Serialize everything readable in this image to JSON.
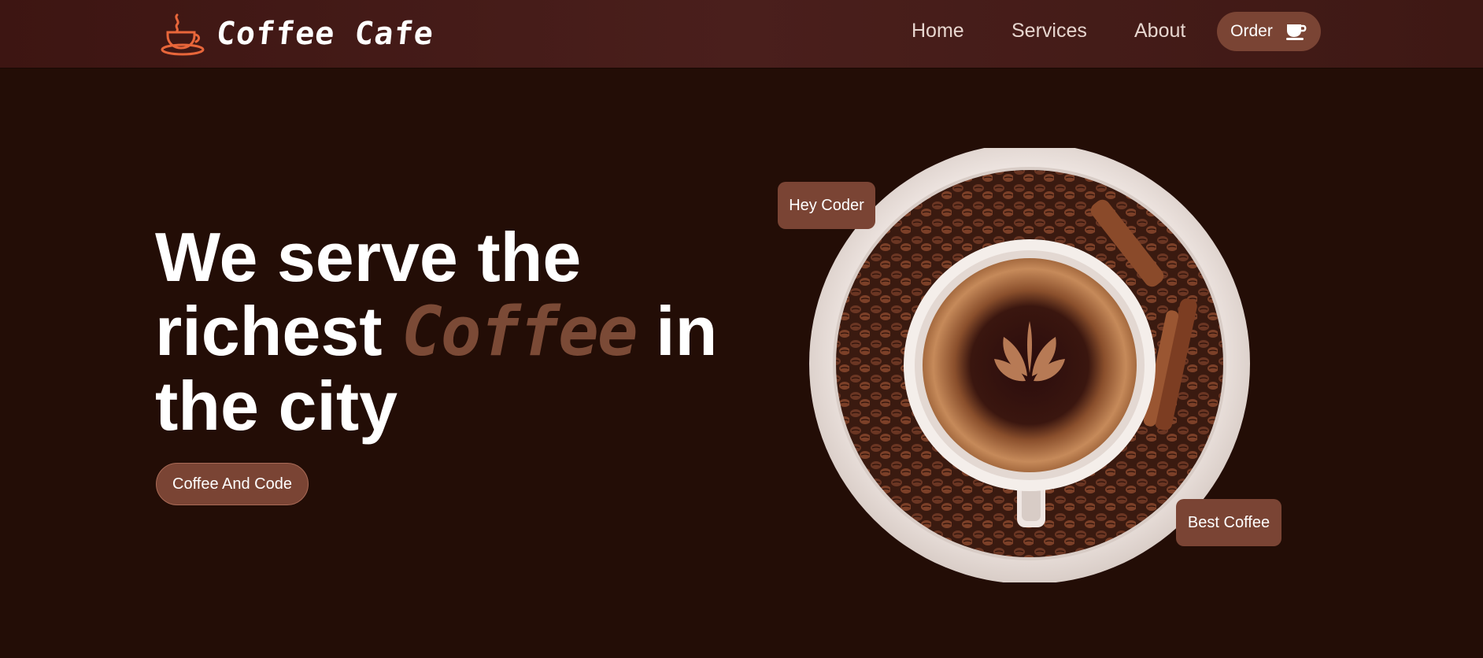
{
  "brand": {
    "name": "Coffee Cafe",
    "icon": "coffee-cup-logo-icon",
    "icon_color": "#e8663a"
  },
  "nav": {
    "links": [
      {
        "label": "Home"
      },
      {
        "label": "Services"
      },
      {
        "label": "About"
      }
    ],
    "order": {
      "label": "Order",
      "icon": "coffee-cup-icon"
    }
  },
  "hero": {
    "line1": "We serve the",
    "line2_before": "richest",
    "line2_accent": "Coffee",
    "line2_after": "in",
    "line3": "the city",
    "cta_label": "Coffee And Code",
    "tags": {
      "top": "Hey Coder",
      "bottom": "Best Coffee"
    },
    "image": "coffee-cup-with-beans-image"
  },
  "colors": {
    "background": "#230d06",
    "navbar": "#4a1f1c",
    "accent": "#7a4434",
    "accent_text": "#7b4a36",
    "brand_icon": "#e8663a"
  }
}
